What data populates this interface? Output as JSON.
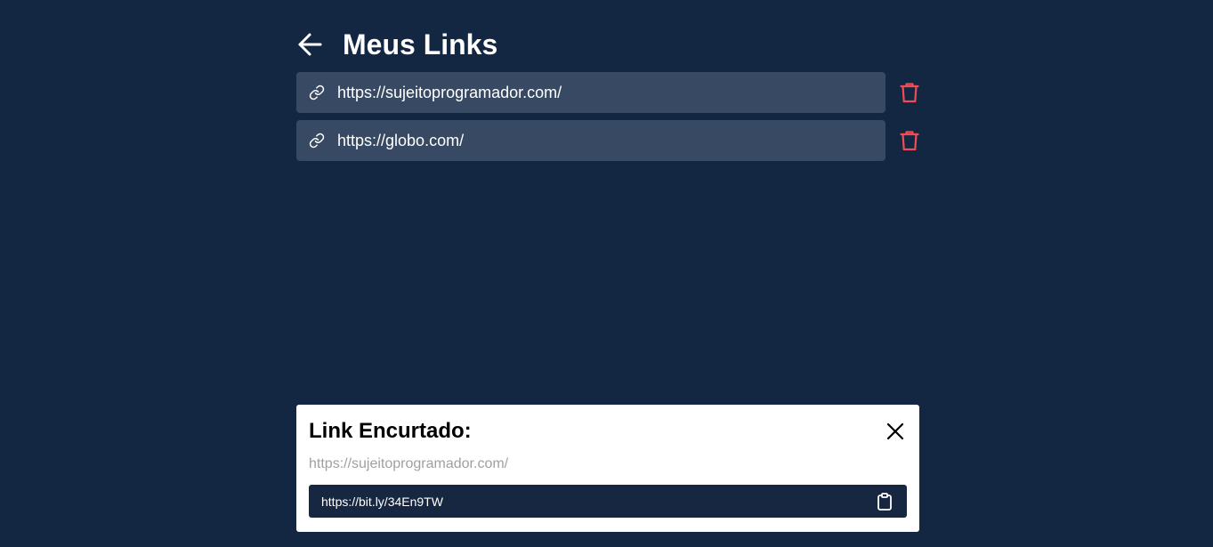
{
  "header": {
    "title": "Meus Links",
    "back_icon": "arrow-left-icon"
  },
  "links": [
    {
      "url": "https://sujeitoprogramador.com/",
      "icon": "link-icon",
      "delete_icon": "trash-icon"
    },
    {
      "url": "https://globo.com/",
      "icon": "link-icon",
      "delete_icon": "trash-icon"
    }
  ],
  "modal": {
    "title": "Link Encurtado:",
    "original_url": "https://sujeitoprogramador.com/",
    "short_url": "https://bit.ly/34En9TW",
    "close_icon": "close-icon",
    "copy_icon": "clipboard-icon"
  },
  "colors": {
    "background": "#132642",
    "card": "#384a63",
    "delete": "#ef4d54",
    "short_box": "#172742"
  }
}
